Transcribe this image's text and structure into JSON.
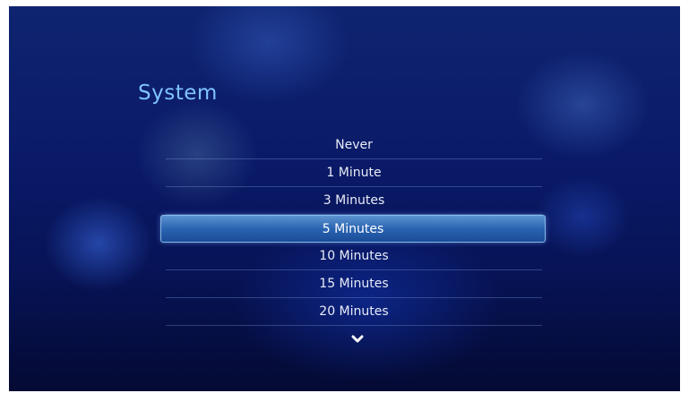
{
  "screen": {
    "title": "System"
  },
  "options": [
    {
      "label": "Never",
      "selected": false
    },
    {
      "label": "1 Minute",
      "selected": false
    },
    {
      "label": "3 Minutes",
      "selected": false
    },
    {
      "label": "5 Minutes",
      "selected": true
    },
    {
      "label": "10 Minutes",
      "selected": false
    },
    {
      "label": "15 Minutes",
      "selected": false
    },
    {
      "label": "20 Minutes",
      "selected": false
    }
  ],
  "scroll_indicator": {
    "icon": "chevron-down-icon"
  },
  "colors": {
    "title": "#7fc4ff",
    "selection_highlight": "#2a64b2",
    "background": "#0a1a68"
  }
}
